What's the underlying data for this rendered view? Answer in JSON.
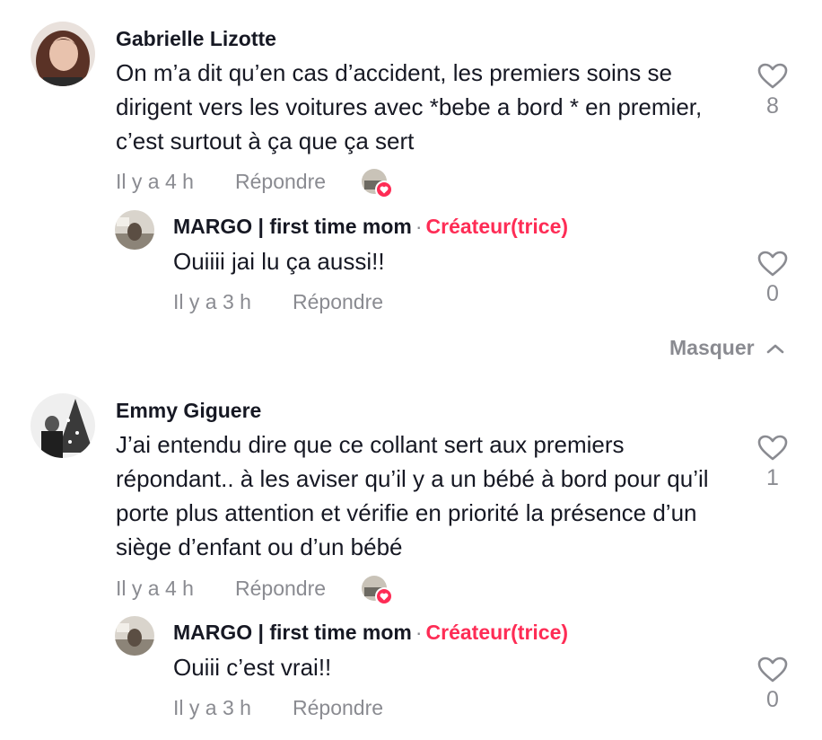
{
  "comments": [
    {
      "author": "Gabrielle Lizotte",
      "text": "On m’a dit qu’en cas d’accident, les premiers soins se dirigent vers les voitures avec *bebe a bord * en premier, c’est surtout à ça que ça sert",
      "time": "Il y a 4 h",
      "reply_label": "Répondre",
      "likes": "8",
      "icons": {
        "like": "heart-outline-icon",
        "creator_liked": "creator-liked-heart-badge"
      },
      "reply": {
        "author": "MARGO | first time mom",
        "separator": "·",
        "badge": "Créateur(trice)",
        "text": "Ouiiii jai lu ça aussi!!",
        "time": "Il y a 3 h",
        "reply_label": "Répondre",
        "likes": "0"
      },
      "collapse_label": "Masquer"
    },
    {
      "author": "Emmy Giguere",
      "text": "J’ai entendu dire que ce collant sert aux premiers répondant.. à les aviser qu’il y a un bébé à bord pour qu’il porte plus attention et vérifie en priorité la présence d’un siège d’enfant ou d’un bébé",
      "time": "Il y a 4 h",
      "reply_label": "Répondre",
      "likes": "1",
      "reply": {
        "author": "MARGO | first time mom",
        "separator": "·",
        "badge": "Créateur(trice)",
        "text": "Ouiii c’est vrai!!",
        "time": "Il y a 3 h",
        "reply_label": "Répondre",
        "likes": "0"
      }
    }
  ],
  "colors": {
    "accent": "#fe2c55",
    "muted": "#8a8b91",
    "text": "#161823"
  }
}
